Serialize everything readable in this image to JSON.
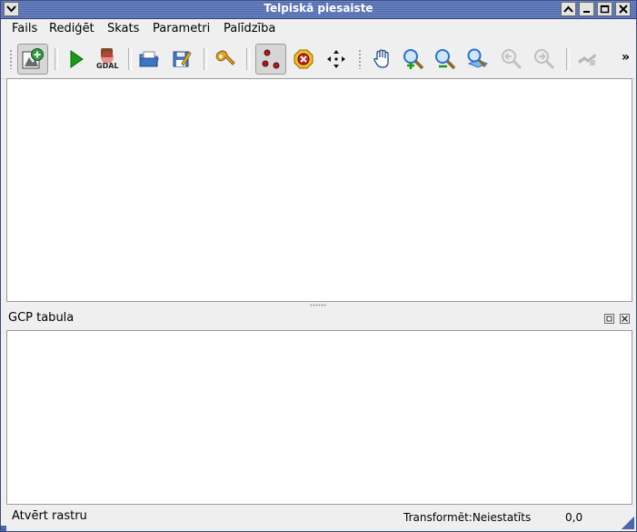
{
  "window": {
    "title": "Telpiskā piesaiste"
  },
  "menu": {
    "items": [
      {
        "label": "Fails"
      },
      {
        "label": "Rediģēt"
      },
      {
        "label": "Skats"
      },
      {
        "label": "Parametri"
      },
      {
        "label": "Palīdzība"
      }
    ]
  },
  "toolbar": {
    "gdal_label": "GDAL",
    "overflow": "»"
  },
  "gcp_panel": {
    "title": "GCP tabula"
  },
  "status": {
    "message": "Atvērt rastru",
    "transform": "Transformēt:Neiestatīts",
    "coords": "0,0"
  },
  "colors": {
    "titlebar": "#4d67ad",
    "accent_green": "#1a9a1a",
    "accent_blue": "#2a6fd0"
  }
}
